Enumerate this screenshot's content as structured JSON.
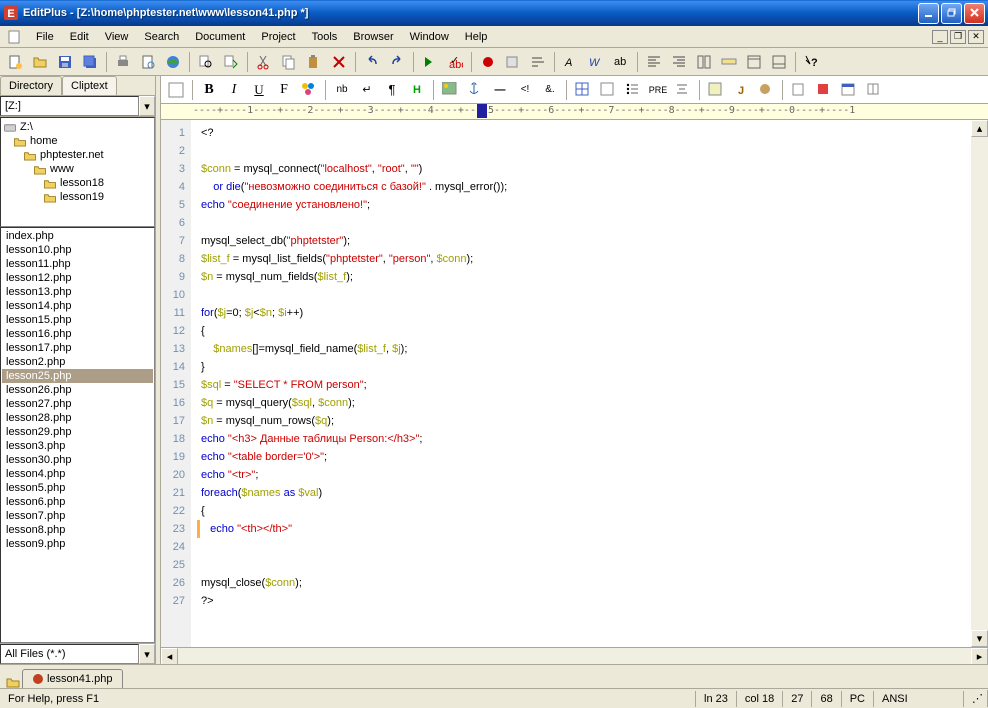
{
  "window": {
    "title": "EditPlus - [Z:\\home\\phptester.net\\www\\lesson41.php *]"
  },
  "menu": [
    "File",
    "Edit",
    "View",
    "Search",
    "Document",
    "Project",
    "Tools",
    "Browser",
    "Window",
    "Help"
  ],
  "sidebar": {
    "tabs": [
      "Directory",
      "Cliptext"
    ],
    "drive": "[Z:]",
    "tree": [
      {
        "label": "Z:\\",
        "indent": 0
      },
      {
        "label": "home",
        "indent": 1
      },
      {
        "label": "phptester.net",
        "indent": 2
      },
      {
        "label": "www",
        "indent": 3
      },
      {
        "label": "lesson18",
        "indent": 4
      },
      {
        "label": "lesson19",
        "indent": 4
      }
    ],
    "files": [
      "index.php",
      "lesson10.php",
      "lesson11.php",
      "lesson12.php",
      "lesson13.php",
      "lesson14.php",
      "lesson15.php",
      "lesson16.php",
      "lesson17.php",
      "lesson2.php",
      "lesson25.php",
      "lesson26.php",
      "lesson27.php",
      "lesson28.php",
      "lesson29.php",
      "lesson3.php",
      "lesson30.php",
      "lesson4.php",
      "lesson5.php",
      "lesson6.php",
      "lesson7.php",
      "lesson8.php",
      "lesson9.php"
    ],
    "selected_file": "lesson25.php",
    "filter": "All Files (*.*)"
  },
  "editor": {
    "ruler": "----+----1----+----2----+----3----+----4----+----5----+----6----+----7----+----8----+----9----+----0----+----1",
    "lines": [
      {
        "n": 1,
        "type": "op",
        "text": "<?"
      },
      {
        "n": 2,
        "type": "blank",
        "text": ""
      },
      {
        "n": 3,
        "type": "raw",
        "html": "<span class='c-var'>$conn</span> = mysql_connect(<span class='c-str'>\"localhost\"</span>, <span class='c-str'>\"root\"</span>, <span class='c-str'>\"\"</span>)"
      },
      {
        "n": 4,
        "type": "raw",
        "html": "    <span class='c-kw'>or die</span>(<span class='c-str'>\"невозможно соединиться с базой!\"</span> . mysql_error());"
      },
      {
        "n": 5,
        "type": "raw",
        "html": "<span class='c-kw'>echo</span> <span class='c-str'>\"соединение установлено!\"</span>;"
      },
      {
        "n": 6,
        "type": "blank",
        "text": ""
      },
      {
        "n": 7,
        "type": "raw",
        "html": "mysql_select_db(<span class='c-str'>\"phptetster\"</span>);"
      },
      {
        "n": 8,
        "type": "raw",
        "html": "<span class='c-var'>$list_f</span> = mysql_list_fields(<span class='c-str'>\"phptetster\"</span>, <span class='c-str'>\"person\"</span>, <span class='c-var'>$conn</span>);"
      },
      {
        "n": 9,
        "type": "raw",
        "html": "<span class='c-var'>$n</span> = mysql_num_fields(<span class='c-var'>$list_f</span>);"
      },
      {
        "n": 10,
        "type": "blank",
        "text": ""
      },
      {
        "n": 11,
        "type": "raw",
        "html": "<span class='c-kw'>for</span>(<span class='c-var'>$j</span>=0; <span class='c-var'>$j</span>&lt;<span class='c-var'>$n</span>; <span class='c-var'>$i</span>++)"
      },
      {
        "n": 12,
        "type": "op",
        "text": "{"
      },
      {
        "n": 13,
        "type": "raw",
        "html": "    <span class='c-var'>$names</span>[]=mysql_field_name(<span class='c-var'>$list_f</span>, <span class='c-var'>$j</span>);"
      },
      {
        "n": 14,
        "type": "op",
        "text": "}"
      },
      {
        "n": 15,
        "type": "raw",
        "html": "<span class='c-var'>$sql</span> = <span class='c-str'>\"SELECT * FROM person\"</span>;"
      },
      {
        "n": 16,
        "type": "raw",
        "html": "<span class='c-var'>$q</span> = mysql_query(<span class='c-var'>$sql</span>, <span class='c-var'>$conn</span>);"
      },
      {
        "n": 17,
        "type": "raw",
        "html": "<span class='c-var'>$n</span> = mysql_num_rows(<span class='c-var'>$q</span>);"
      },
      {
        "n": 18,
        "type": "raw",
        "html": "<span class='c-kw'>echo</span> <span class='c-str'>\"&lt;h3&gt; Данные таблицы Person:&lt;/h3&gt;\"</span>;"
      },
      {
        "n": 19,
        "type": "raw",
        "html": "<span class='c-kw'>echo</span> <span class='c-str'>\"&lt;table border='0'&gt;\"</span>;"
      },
      {
        "n": 20,
        "type": "raw",
        "html": "<span class='c-kw'>echo</span> <span class='c-str'>\"&lt;tr&gt;\"</span>;"
      },
      {
        "n": 21,
        "type": "raw",
        "html": "<span class='c-kw'>foreach</span>(<span class='c-var'>$names</span> <span class='c-kw'>as</span> <span class='c-var'>$val</span>)"
      },
      {
        "n": 22,
        "type": "op",
        "text": "{"
      },
      {
        "n": 23,
        "type": "raw",
        "html": "   <span class='c-kw'>echo</span> <span class='c-str'>\"&lt;th&gt;&lt;/th&gt;\"</span>"
      },
      {
        "n": 24,
        "type": "blank",
        "text": ""
      },
      {
        "n": 25,
        "type": "blank",
        "text": ""
      },
      {
        "n": 26,
        "type": "raw",
        "html": "mysql_close(<span class='c-var'>$conn</span>);"
      },
      {
        "n": 27,
        "type": "op",
        "text": "?>"
      }
    ]
  },
  "doctab": {
    "label": "lesson41.php"
  },
  "status": {
    "help": "For Help, press F1",
    "line": "ln 23",
    "col": "col 18",
    "v1": "27",
    "v2": "68",
    "mode": "PC",
    "enc": "ANSI"
  }
}
